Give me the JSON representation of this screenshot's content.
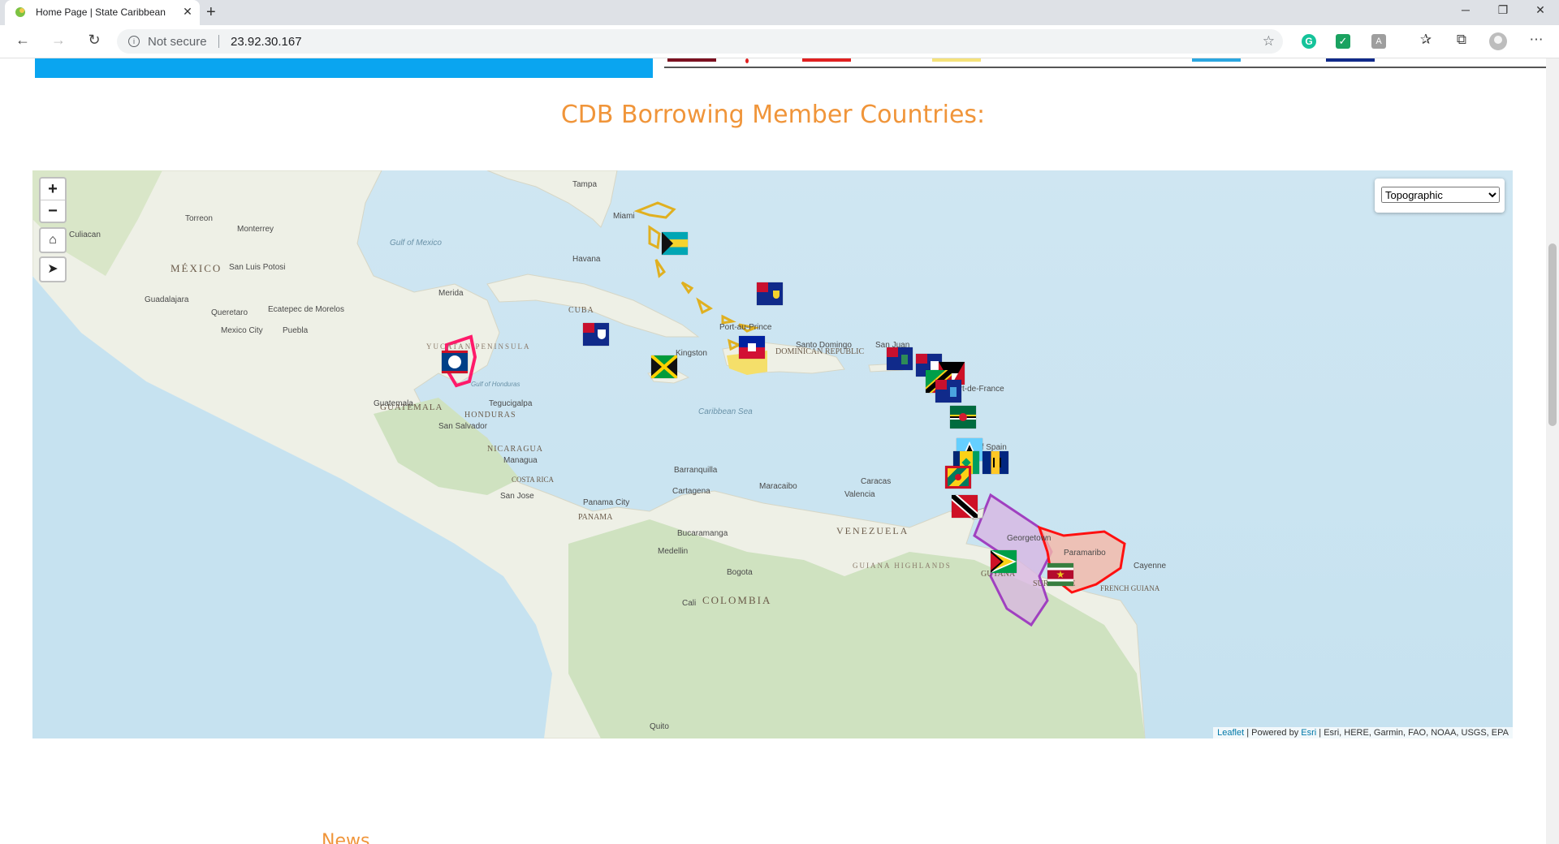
{
  "browser": {
    "tab_title": "Home Page | State Caribbean",
    "tab_close": "✕",
    "new_tab": "+",
    "security_label": "Not secure",
    "url": "23.92.30.167",
    "window_controls": {
      "minimize": "─",
      "maximize": "❐",
      "close": "✕"
    }
  },
  "page": {
    "section_title": "CDB Borrowing Member Countries:",
    "next_heading": "News"
  },
  "map": {
    "zoom_in": "+",
    "zoom_out": "−",
    "home_icon": "home-icon",
    "locate_icon": "locate-icon",
    "basemap": {
      "selected": "Topographic",
      "options": [
        "Topographic"
      ]
    },
    "attribution": {
      "leaflet": "Leaflet",
      "powered_by": " | Powered by ",
      "esri": "Esri",
      "sources": " | Esri, HERE, Garmin, FAO, NOAA, USGS, EPA"
    },
    "labels": {
      "countries": [
        "MÉXICO",
        "CUBA",
        "DOMINICAN REPUBLIC",
        "GUATEMALA",
        "HONDURAS",
        "NICARAGUA",
        "COSTA RICA",
        "PANAMA",
        "VENEZUELA",
        "COLOMBIA",
        "GUYANA",
        "SURINAME",
        "FRENCH GUIANA"
      ],
      "cities": [
        "Tampa",
        "Miami",
        "Torreon",
        "Monterrey",
        "Culiacan",
        "San Luis Potosi",
        "Guadalajara",
        "Queretaro",
        "Ecatepec de Morelos",
        "Mexico City",
        "Puebla",
        "Merida",
        "Havana",
        "Kingston",
        "Port-au-Prince",
        "Santo Domingo",
        "San Juan",
        "Fort-de-France",
        "Port of Spain",
        "Guatemala",
        "Tegucigalpa",
        "San Salvador",
        "Managua",
        "San Jose",
        "Panama City",
        "Barranquilla",
        "Cartagena",
        "Maracaibo",
        "Caracas",
        "Valencia",
        "Bucaramanga",
        "Medellin",
        "Bogota",
        "Cali",
        "Quito",
        "Georgetown",
        "Paramaribo",
        "Cayenne"
      ],
      "water": [
        "Gulf of Mexico",
        "Caribbean Sea",
        "Gulf of Honduras"
      ],
      "regions": [
        "YUCATAN PENINSULA",
        "GUIANA HIGHLANDS"
      ]
    },
    "flags": [
      {
        "country": "Bahamas",
        "icon": "bahamas-flag-icon"
      },
      {
        "country": "Turks and Caicos Islands",
        "icon": "turks-caicos-flag-icon"
      },
      {
        "country": "Cayman Islands",
        "icon": "cayman-flag-icon"
      },
      {
        "country": "Jamaica",
        "icon": "jamaica-flag-icon"
      },
      {
        "country": "Haiti",
        "icon": "haiti-flag-icon"
      },
      {
        "country": "British Virgin Islands",
        "icon": "bvi-flag-icon"
      },
      {
        "country": "Anguilla",
        "icon": "anguilla-flag-icon"
      },
      {
        "country": "Antigua and Barbuda",
        "icon": "antigua-flag-icon"
      },
      {
        "country": "St. Kitts and Nevis",
        "icon": "stkitts-flag-icon"
      },
      {
        "country": "Montserrat",
        "icon": "montserrat-flag-icon"
      },
      {
        "country": "Dominica",
        "icon": "dominica-flag-icon"
      },
      {
        "country": "St. Lucia",
        "icon": "stlucia-flag-icon"
      },
      {
        "country": "St. Vincent and the Grenadines",
        "icon": "stvincent-flag-icon"
      },
      {
        "country": "Barbados",
        "icon": "barbados-flag-icon"
      },
      {
        "country": "Grenada",
        "icon": "grenada-flag-icon"
      },
      {
        "country": "Trinidad and Tobago",
        "icon": "trinidad-flag-icon"
      },
      {
        "country": "Belize",
        "icon": "belize-flag-icon"
      },
      {
        "country": "Guyana",
        "icon": "guyana-flag-icon"
      },
      {
        "country": "Suriname",
        "icon": "suriname-flag-icon"
      }
    ],
    "colors": {
      "water": "#c6e2f0",
      "land": "#eef0e6",
      "vegetation": "#cfe2c0",
      "bahamas_outline": "#e0b020",
      "belize_highlight": "#ff1a6a",
      "guyana_fill": "#d8b4e2",
      "guyana_outline": "#a040c0",
      "suriname_fill": "#f6b8a8",
      "suriname_outline": "#ff1010"
    }
  },
  "theme": {
    "accent": "#f0953a",
    "banner_blue": "#0aa5f0"
  }
}
